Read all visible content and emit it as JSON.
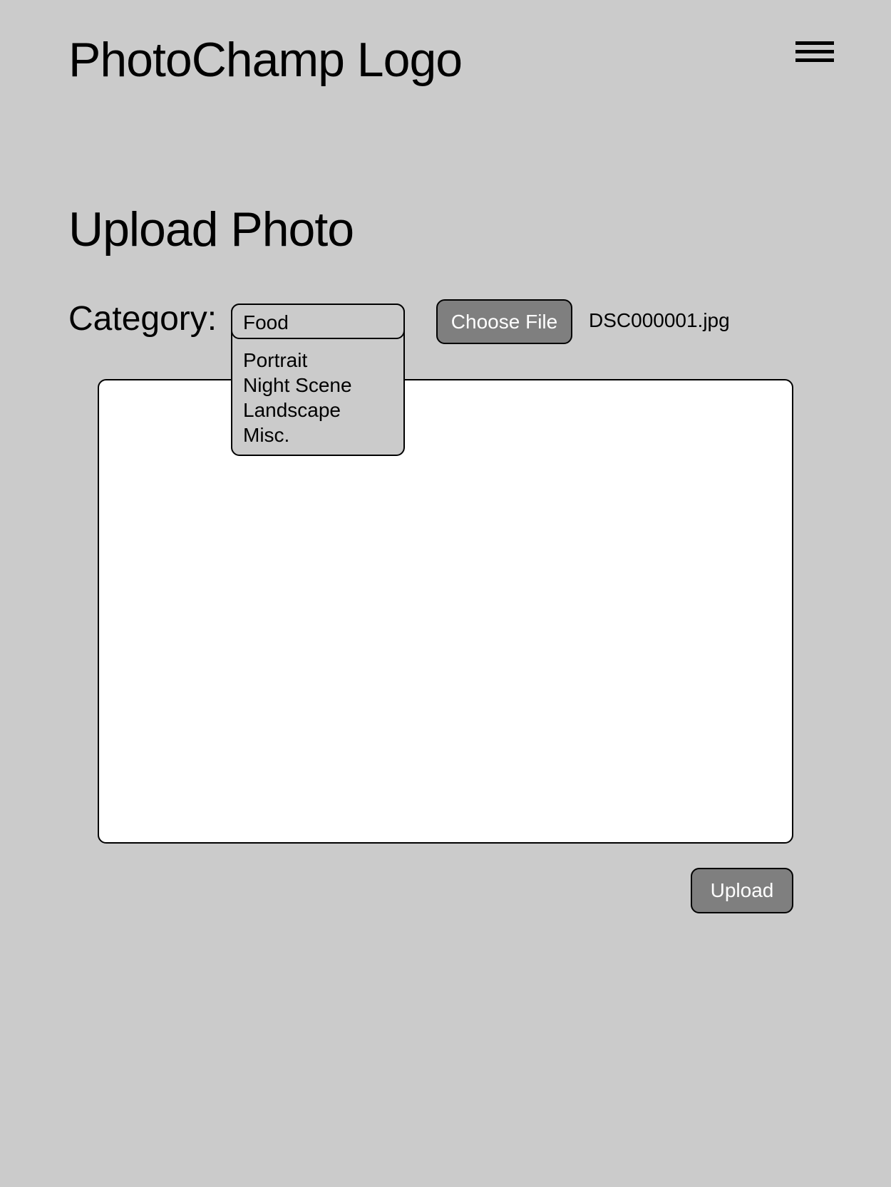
{
  "header": {
    "logo_text": "PhotoChamp Logo",
    "menu_icon": "hamburger-menu-icon"
  },
  "main": {
    "title": "Upload Photo",
    "category": {
      "label": "Category:",
      "selected": "Food",
      "options": [
        "Portrait",
        "Night Scene",
        "Landscape",
        "Misc."
      ]
    },
    "file": {
      "choose_label": "Choose File",
      "file_name": "DSC000001.jpg"
    },
    "upload_label": "Upload"
  },
  "colors": {
    "background": "#cbcbcb",
    "button_fill": "#7f7f7f",
    "button_text": "#ffffff",
    "preview_fill": "#ffffff"
  }
}
